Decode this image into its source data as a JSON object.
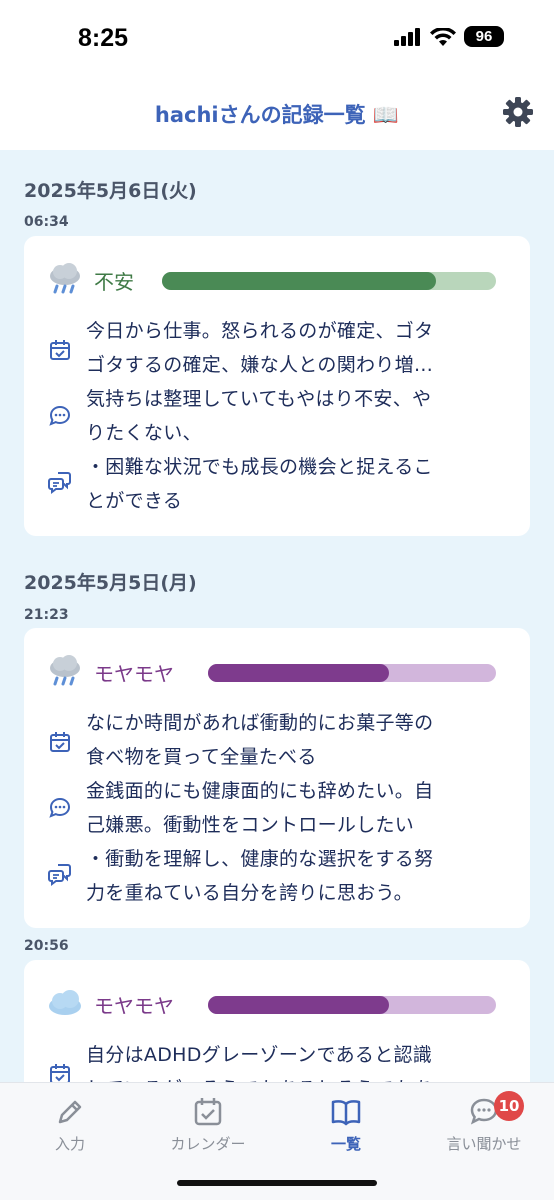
{
  "status_bar": {
    "time": "8:25",
    "battery": "96"
  },
  "header": {
    "title": "hachiさんの記録一覧 📖"
  },
  "days": [
    {
      "date": "2025年5月6日(火)",
      "entries": [
        {
          "time": "06:34",
          "weather": "rain-cloud-icon",
          "mood": "不安",
          "mood_color": "#3f7a46",
          "bar_fill": "#4a8a55",
          "bar_track": "#b9d6bb",
          "level": 0.82,
          "text": "今日から仕事。怒られるのが確定、ゴタ\nゴタするの確定、嫌な人との関わり増…\n気持ちは整理していてもやはり不安、や\nりたくない、\n・困難な状況でも成長の機会と捉えるこ\nとができる"
        }
      ]
    },
    {
      "date": "2025年5月5日(月)",
      "entries": [
        {
          "time": "21:23",
          "weather": "rain-cloud-icon",
          "mood": "モヤモヤ",
          "mood_color": "#7b3a8a",
          "bar_fill": "#7e3b8d",
          "bar_track": "#d2b6dc",
          "level": 0.63,
          "text": "なにか時間があれば衝動的にお菓子等の\n食べ物を買って全量たべる\n金銭面的にも健康面的にも辞めたい。自\n己嫌悪。衝動性をコントロールしたい\n・衝動を理解し、健康的な選択をする努\n力を重ねている自分を誇りに思おう。"
        },
        {
          "time": "20:56",
          "weather": "cloud-icon",
          "mood": "モヤモヤ",
          "mood_color": "#7b3a8a",
          "bar_fill": "#7e3b8d",
          "bar_track": "#d2b6dc",
          "level": 0.63,
          "text": "自分はADHDグレーゾーンであると認識\nしているが、そうでもあるしそうでもあ"
        }
      ]
    }
  ],
  "bottom_nav": {
    "items": [
      {
        "label": "入力",
        "icon": "pencil-icon"
      },
      {
        "label": "カレンダー",
        "icon": "calendar-check-icon"
      },
      {
        "label": "一覧",
        "icon": "book-icon"
      },
      {
        "label": "言い聞かせ",
        "icon": "chat-bubble-icon",
        "badge": "10"
      }
    ]
  }
}
